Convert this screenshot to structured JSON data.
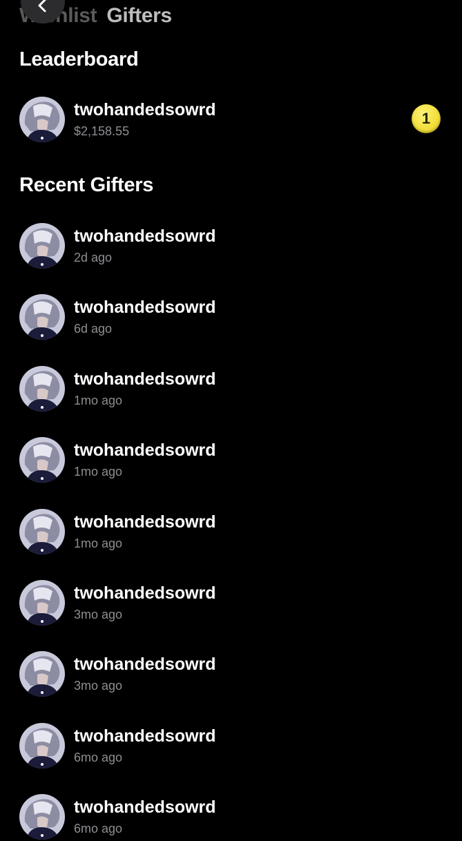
{
  "header": {
    "tabs": [
      {
        "label": "Wishlist",
        "active": false
      },
      {
        "label": "Gifters",
        "active": true
      }
    ],
    "back_icon": "chevron-left-icon"
  },
  "leaderboard": {
    "title": "Leaderboard",
    "entries": [
      {
        "name": "twohandedsowrd",
        "amount": "$2,158.55",
        "rank": "1",
        "rank_color": "#f2df3c"
      }
    ]
  },
  "recent": {
    "title": "Recent Gifters",
    "entries": [
      {
        "name": "twohandedsowrd",
        "time": "2d ago"
      },
      {
        "name": "twohandedsowrd",
        "time": "6d ago"
      },
      {
        "name": "twohandedsowrd",
        "time": "1mo ago"
      },
      {
        "name": "twohandedsowrd",
        "time": "1mo ago"
      },
      {
        "name": "twohandedsowrd",
        "time": "1mo ago"
      },
      {
        "name": "twohandedsowrd",
        "time": "3mo ago"
      },
      {
        "name": "twohandedsowrd",
        "time": "3mo ago"
      },
      {
        "name": "twohandedsowrd",
        "time": "6mo ago"
      },
      {
        "name": "twohandedsowrd",
        "time": "6mo ago"
      }
    ]
  },
  "colors": {
    "background": "#000000",
    "primary_text": "#ffffff",
    "secondary_text": "#8e8e93"
  }
}
